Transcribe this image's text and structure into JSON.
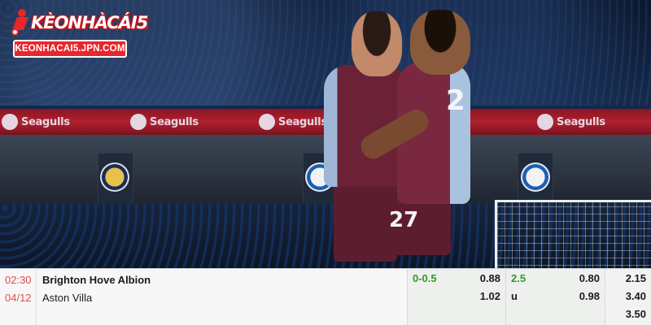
{
  "brand": {
    "name": "KÈONHÀCÁI5",
    "url": "KEONHACAI5.JPN.COM"
  },
  "photo": {
    "ad_board_text": "Seagulls",
    "shirt_numbers": [
      "27",
      "2"
    ]
  },
  "match": {
    "time": "02:30",
    "date": "04/12",
    "home_team": "Brighton Hove Albion",
    "away_team": "Aston Villa",
    "handicap": {
      "line": "0-0.5",
      "home_odds": "0.88",
      "away_odds": "1.02"
    },
    "over_under": {
      "line": "2.5",
      "under_label": "u",
      "over_odds": "0.80",
      "under_odds": "0.98"
    },
    "one_x_two": {
      "home": "2.15",
      "away": "3.40",
      "draw": "3.50"
    }
  },
  "colors": {
    "brand_red": "#e8262b",
    "time_red": "#e24c4c",
    "line_green": "#2e9a2e",
    "villa_claret": "#6b2236"
  }
}
